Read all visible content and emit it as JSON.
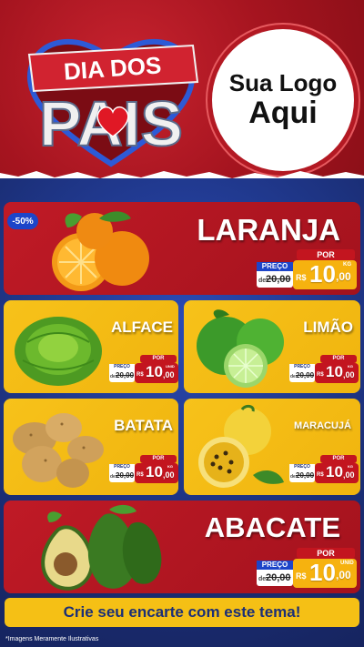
{
  "header": {
    "badge_line1": "DIA DOS",
    "badge_line2": "PAIS",
    "logo_line1": "Sua Logo",
    "logo_line2": "Aqui",
    "colors": {
      "red": "#a5141f",
      "blue": "#1b2f78",
      "yellow": "#f5c015"
    }
  },
  "discount_badge": "-50%",
  "products": [
    {
      "name": "LARANJA",
      "por": "POR",
      "old_label": "PREÇO",
      "de": "de",
      "old_price": "20,00",
      "currency": "R$",
      "price_int": "10",
      "price_dec": ",00",
      "unit": "KG",
      "icon": "orange-icon"
    },
    {
      "name": "ALFACE",
      "por": "POR",
      "old_label": "PREÇO",
      "de": "de",
      "old_price": "20,00",
      "currency": "R$",
      "price_int": "10",
      "price_dec": ",00",
      "unit": "UNID",
      "icon": "lettuce-icon"
    },
    {
      "name": "LIMÃO",
      "por": "POR",
      "old_label": "PREÇO",
      "de": "de",
      "old_price": "20,00",
      "currency": "R$",
      "price_int": "10",
      "price_dec": ",00",
      "unit": "KG",
      "icon": "lime-icon"
    },
    {
      "name": "BATATA",
      "por": "POR",
      "old_label": "PREÇO",
      "de": "de",
      "old_price": "20,00",
      "currency": "R$",
      "price_int": "10",
      "price_dec": ",00",
      "unit": "KG",
      "icon": "potato-icon"
    },
    {
      "name": "MARACUJÁ",
      "por": "POR",
      "old_label": "PREÇO",
      "de": "de",
      "old_price": "20,00",
      "currency": "R$",
      "price_int": "10",
      "price_dec": ",00",
      "unit": "KG",
      "icon": "passionfruit-icon"
    },
    {
      "name": "ABACATE",
      "por": "POR",
      "old_label": "PREÇO",
      "de": "de",
      "old_price": "20,00",
      "currency": "R$",
      "price_int": "10",
      "price_dec": ",00",
      "unit": "UNID",
      "icon": "avocado-icon"
    }
  ],
  "cta": "Crie seu encarte com este tema!",
  "footer_note": "*Imagens Meramente Ilustrativas"
}
